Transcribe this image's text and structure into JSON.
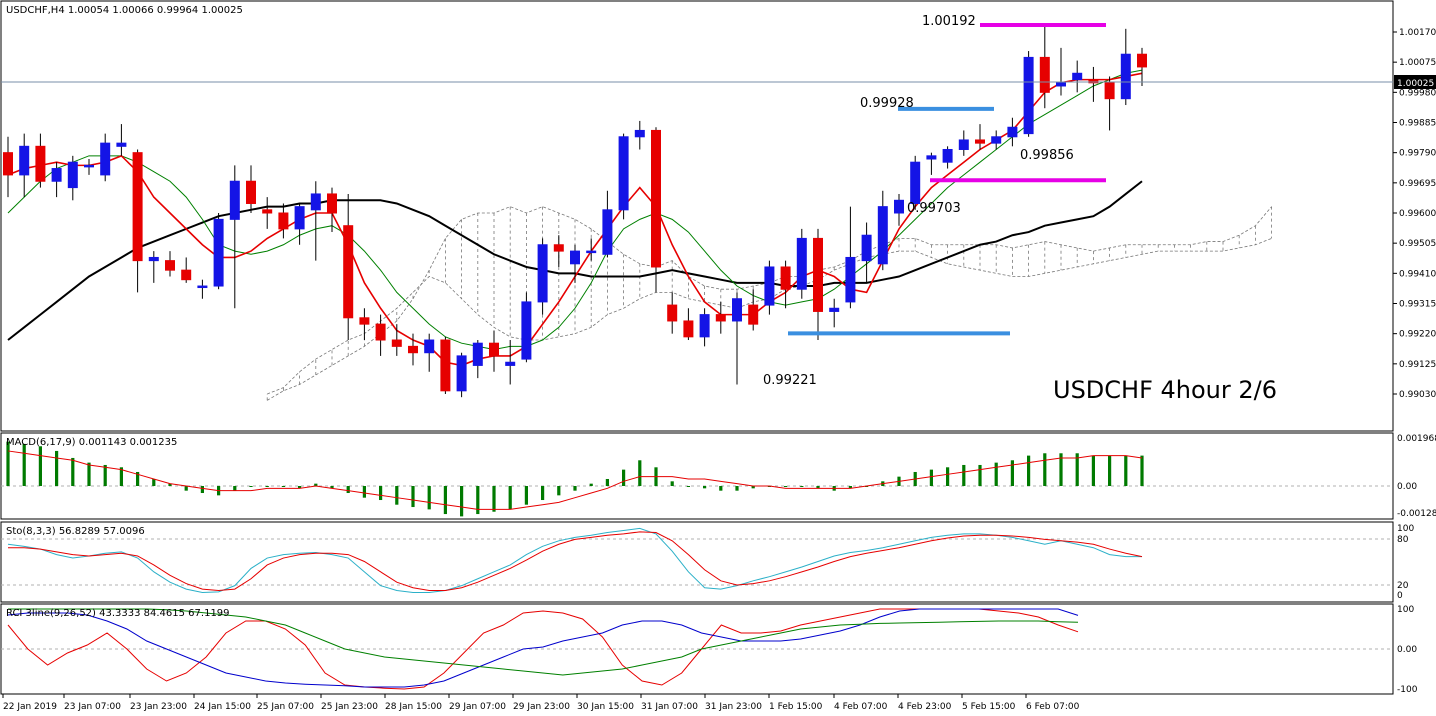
{
  "main_panel": {
    "header": "USDCHF,H4  1.00054 1.00066 0.99964 1.00025",
    "annotation": "USDCHF 4hour 2/6",
    "current_price_label": "1.00025",
    "price_ticks": [
      "1.00170",
      "1.00075",
      "0.99980",
      "0.99885",
      "0.99790",
      "0.99695",
      "0.99600",
      "0.99505",
      "0.99410",
      "0.99315",
      "0.99220",
      "0.99125",
      "0.99030"
    ],
    "level_labels": [
      {
        "text": "1.00192"
      },
      {
        "text": "0.99928"
      },
      {
        "text": "0.99703"
      },
      {
        "text": "0.99856"
      },
      {
        "text": "0.99221"
      }
    ]
  },
  "macd_panel": {
    "header": "MACD(6,17,9) 0.001143 0.001235",
    "ticks": [
      "0.001968",
      "0.00",
      "-0.001288"
    ]
  },
  "stoch_panel": {
    "header": "Sto(8,3,3) 56.8289 57.0096",
    "ticks": [
      "100",
      "80",
      "20",
      "0"
    ]
  },
  "rci_panel": {
    "header": "RCI 3line(9,26,52) 43.3333 84.4615 67.1199",
    "ticks": [
      "100",
      "0.00",
      "-100"
    ]
  },
  "time_axis": [
    "22 Jan 2019",
    "23 Jan 07:00",
    "23 Jan 23:00",
    "24 Jan 15:00",
    "25 Jan 07:00",
    "25 Jan 23:00",
    "28 Jan 15:00",
    "29 Jan 07:00",
    "29 Jan 23:00",
    "30 Jan 15:00",
    "31 Jan 07:00",
    "31 Jan 23:00",
    "1 Feb 15:00",
    "4 Feb 07:00",
    "4 Feb 23:00",
    "5 Feb 15:00",
    "6 Feb 07:00"
  ],
  "colors": {
    "bull": "#1414e6",
    "bear": "#e60000",
    "ma_fast": "#e60000",
    "ma_mid": "#008000",
    "ma_slow": "#000000",
    "line_blue": "#3a8fe0",
    "line_magenta": "#e600e6",
    "macd_hist": "#007a00",
    "macd_signal": "#e60000",
    "sto_main": "#2bb0c8",
    "sto_signal": "#e60000",
    "rci_short": "#e60000",
    "rci_mid": "#0000cc",
    "rci_long": "#008000"
  },
  "chart_data": [
    {
      "type": "candlestick",
      "title": "USDCHF,H4",
      "ylim": [
        0.9903,
        1.0022
      ],
      "candles": [
        {
          "o": 0.9979,
          "h": 0.9984,
          "l": 0.9965,
          "c": 0.9972
        },
        {
          "o": 0.9972,
          "h": 0.9985,
          "l": 0.9965,
          "c": 0.9981
        },
        {
          "o": 0.9981,
          "h": 0.9985,
          "l": 0.9968,
          "c": 0.997
        },
        {
          "o": 0.997,
          "h": 0.9976,
          "l": 0.9965,
          "c": 0.9974
        },
        {
          "o": 0.9968,
          "h": 0.9978,
          "l": 0.9964,
          "c": 0.9976
        },
        {
          "o": 0.9975,
          "h": 0.9977,
          "l": 0.9972,
          "c": 0.9975
        },
        {
          "o": 0.9972,
          "h": 0.9985,
          "l": 0.997,
          "c": 0.9982
        },
        {
          "o": 0.9981,
          "h": 0.9988,
          "l": 0.9978,
          "c": 0.9982
        },
        {
          "o": 0.9979,
          "h": 0.998,
          "l": 0.9935,
          "c": 0.9945
        },
        {
          "o": 0.9945,
          "h": 0.9948,
          "l": 0.9938,
          "c": 0.9946
        },
        {
          "o": 0.9945,
          "h": 0.9948,
          "l": 0.994,
          "c": 0.9942
        },
        {
          "o": 0.9942,
          "h": 0.9946,
          "l": 0.9938,
          "c": 0.9939
        },
        {
          "o": 0.9937,
          "h": 0.9939,
          "l": 0.9933,
          "c": 0.9937
        },
        {
          "o": 0.9937,
          "h": 0.996,
          "l": 0.9936,
          "c": 0.9958
        },
        {
          "o": 0.9958,
          "h": 0.9975,
          "l": 0.993,
          "c": 0.997
        },
        {
          "o": 0.997,
          "h": 0.9975,
          "l": 0.996,
          "c": 0.9963
        },
        {
          "o": 0.9961,
          "h": 0.9965,
          "l": 0.9955,
          "c": 0.996
        },
        {
          "o": 0.996,
          "h": 0.9963,
          "l": 0.9952,
          "c": 0.9955
        },
        {
          "o": 0.9955,
          "h": 0.9963,
          "l": 0.995,
          "c": 0.9962
        },
        {
          "o": 0.9961,
          "h": 0.997,
          "l": 0.9945,
          "c": 0.9966
        },
        {
          "o": 0.9966,
          "h": 0.9968,
          "l": 0.9954,
          "c": 0.996
        },
        {
          "o": 0.9956,
          "h": 0.9966,
          "l": 0.992,
          "c": 0.9927
        },
        {
          "o": 0.9927,
          "h": 0.993,
          "l": 0.992,
          "c": 0.9925
        },
        {
          "o": 0.9925,
          "h": 0.9928,
          "l": 0.9915,
          "c": 0.992
        },
        {
          "o": 0.992,
          "h": 0.9925,
          "l": 0.9915,
          "c": 0.9918
        },
        {
          "o": 0.9918,
          "h": 0.9922,
          "l": 0.9912,
          "c": 0.9916
        },
        {
          "o": 0.9916,
          "h": 0.9922,
          "l": 0.991,
          "c": 0.992
        },
        {
          "o": 0.992,
          "h": 0.9921,
          "l": 0.9903,
          "c": 0.9904
        },
        {
          "o": 0.9904,
          "h": 0.9916,
          "l": 0.9902,
          "c": 0.9915
        },
        {
          "o": 0.9912,
          "h": 0.992,
          "l": 0.9908,
          "c": 0.9919
        },
        {
          "o": 0.9919,
          "h": 0.9923,
          "l": 0.991,
          "c": 0.9915
        },
        {
          "o": 0.9912,
          "h": 0.992,
          "l": 0.9906,
          "c": 0.9913
        },
        {
          "o": 0.9914,
          "h": 0.9935,
          "l": 0.9913,
          "c": 0.9932
        },
        {
          "o": 0.9932,
          "h": 0.9952,
          "l": 0.9928,
          "c": 0.995
        },
        {
          "o": 0.995,
          "h": 0.9953,
          "l": 0.9943,
          "c": 0.9948
        },
        {
          "o": 0.9944,
          "h": 0.995,
          "l": 0.9938,
          "c": 0.9948
        },
        {
          "o": 0.9948,
          "h": 0.9952,
          "l": 0.9945,
          "c": 0.9948
        },
        {
          "o": 0.9947,
          "h": 0.9967,
          "l": 0.9946,
          "c": 0.9961
        },
        {
          "o": 0.9961,
          "h": 0.9985,
          "l": 0.9958,
          "c": 0.9984
        },
        {
          "o": 0.9984,
          "h": 0.9989,
          "l": 0.998,
          "c": 0.9986
        },
        {
          "o": 0.9986,
          "h": 0.9987,
          "l": 0.9935,
          "c": 0.9943
        },
        {
          "o": 0.9931,
          "h": 0.9935,
          "l": 0.9922,
          "c": 0.9926
        },
        {
          "o": 0.9926,
          "h": 0.993,
          "l": 0.992,
          "c": 0.9921
        },
        {
          "o": 0.9921,
          "h": 0.993,
          "l": 0.9918,
          "c": 0.9928
        },
        {
          "o": 0.9928,
          "h": 0.9932,
          "l": 0.9922,
          "c": 0.9926
        },
        {
          "o": 0.9926,
          "h": 0.9935,
          "l": 0.9906,
          "c": 0.9933
        },
        {
          "o": 0.9931,
          "h": 0.9936,
          "l": 0.9923,
          "c": 0.9925
        },
        {
          "o": 0.9931,
          "h": 0.9945,
          "l": 0.9928,
          "c": 0.9943
        },
        {
          "o": 0.9943,
          "h": 0.9945,
          "l": 0.993,
          "c": 0.9936
        },
        {
          "o": 0.9936,
          "h": 0.9955,
          "l": 0.9933,
          "c": 0.9952
        },
        {
          "o": 0.9952,
          "h": 0.9955,
          "l": 0.992,
          "c": 0.9929
        },
        {
          "o": 0.9929,
          "h": 0.9933,
          "l": 0.9924,
          "c": 0.993
        },
        {
          "o": 0.9932,
          "h": 0.9962,
          "l": 0.993,
          "c": 0.9946
        },
        {
          "o": 0.9945,
          "h": 0.9957,
          "l": 0.9938,
          "c": 0.9953
        },
        {
          "o": 0.9944,
          "h": 0.9967,
          "l": 0.9942,
          "c": 0.9962
        },
        {
          "o": 0.996,
          "h": 0.9966,
          "l": 0.9956,
          "c": 0.9964
        },
        {
          "o": 0.9963,
          "h": 0.9978,
          "l": 0.9961,
          "c": 0.9976
        },
        {
          "o": 0.9977,
          "h": 0.9979,
          "l": 0.9972,
          "c": 0.9978
        },
        {
          "o": 0.9976,
          "h": 0.9981,
          "l": 0.9974,
          "c": 0.998
        },
        {
          "o": 0.998,
          "h": 0.9986,
          "l": 0.9978,
          "c": 0.9983
        },
        {
          "o": 0.9983,
          "h": 0.9988,
          "l": 0.998,
          "c": 0.9982
        },
        {
          "o": 0.9982,
          "h": 0.9986,
          "l": 0.998,
          "c": 0.9984
        },
        {
          "o": 0.9984,
          "h": 0.999,
          "l": 0.9981,
          "c": 0.9987
        },
        {
          "o": 0.9985,
          "h": 1.0011,
          "l": 0.9984,
          "c": 1.0009
        },
        {
          "o": 1.0009,
          "h": 1.0019,
          "l": 0.9993,
          "c": 0.9998
        },
        {
          "o": 1.0,
          "h": 1.0012,
          "l": 0.9997,
          "c": 1.0001
        },
        {
          "o": 1.0002,
          "h": 1.0008,
          "l": 0.9998,
          "c": 1.0004
        },
        {
          "o": 1.0002,
          "h": 1.0006,
          "l": 0.9995,
          "c": 1.0001
        },
        {
          "o": 1.0001,
          "h": 1.0003,
          "l": 0.9986,
          "c": 0.9996
        },
        {
          "o": 0.9996,
          "h": 1.0018,
          "l": 0.9994,
          "c": 1.001
        },
        {
          "o": 1.001,
          "h": 1.0012,
          "l": 1.0,
          "c": 1.0006
        }
      ]
    },
    {
      "type": "bar",
      "title": "MACD(6,17,9) 0.001143 0.001235",
      "values": [
        0.0019,
        0.0018,
        0.0017,
        0.0015,
        0.0012,
        0.001,
        0.0009,
        0.0008,
        0.0006,
        0.0003,
        0.0001,
        -0.0002,
        -0.0003,
        -0.0004,
        -0.0002,
        0.0,
        0.0,
        0.0,
        -0.0001,
        0.0001,
        -0.0001,
        -0.0003,
        -0.0005,
        -0.0006,
        -0.0008,
        -0.0009,
        -0.001,
        -0.0012,
        -0.0013,
        -0.0012,
        -0.0011,
        -0.001,
        -0.0008,
        -0.0006,
        -0.0004,
        -0.0002,
        0.0001,
        0.0003,
        0.0007,
        0.0011,
        0.0008,
        0.0002,
        0.0,
        -0.0001,
        -0.0002,
        -0.0002,
        -0.0001,
        0.0,
        0.0,
        0.0,
        -0.0001,
        -0.0002,
        -0.0001,
        0.0,
        0.0002,
        0.0004,
        0.0006,
        0.0007,
        0.0008,
        0.0009,
        0.0009,
        0.001,
        0.0011,
        0.0013,
        0.0014,
        0.0014,
        0.0014,
        0.0013,
        0.0013,
        0.0013,
        0.0013
      ],
      "signal": [
        0.0015,
        0.0014,
        0.0013,
        0.0012,
        0.0011,
        0.0009,
        0.0008,
        0.0007,
        0.0005,
        0.0003,
        0.0001,
        0.0,
        -0.0001,
        -0.0002,
        -0.0002,
        -0.0002,
        -0.0001,
        -0.0001,
        -0.0001,
        0.0,
        -0.0001,
        -0.0002,
        -0.0003,
        -0.0004,
        -0.0005,
        -0.0006,
        -0.0007,
        -0.0008,
        -0.0009,
        -0.001,
        -0.001,
        -0.001,
        -0.0009,
        -0.0008,
        -0.0007,
        -0.0005,
        -0.0003,
        -0.0001,
        0.0002,
        0.0004,
        0.0004,
        0.0004,
        0.0003,
        0.0003,
        0.0002,
        0.0001,
        0.0,
        0.0,
        -0.0001,
        -0.0001,
        -0.0001,
        -0.0001,
        -0.0001,
        0.0,
        0.0001,
        0.0002,
        0.0003,
        0.0004,
        0.0005,
        0.0006,
        0.0007,
        0.0008,
        0.0009,
        0.001,
        0.0011,
        0.0012,
        0.0012,
        0.0013,
        0.0013,
        0.0013,
        0.0012
      ],
      "ylim": [
        -0.0013,
        0.002
      ]
    },
    {
      "type": "line",
      "title": "Sto(8,3,3) 56.8289 57.0096",
      "ylim": [
        0,
        100
      ],
      "series": [
        {
          "values": [
            75,
            72,
            68,
            60,
            55,
            58,
            62,
            64,
            55,
            35,
            20,
            10,
            5,
            6,
            15,
            40,
            55,
            60,
            62,
            63,
            60,
            55,
            35,
            15,
            8,
            5,
            5,
            8,
            15,
            25,
            35,
            45,
            60,
            72,
            80,
            85,
            88,
            92,
            95,
            98,
            90,
            65,
            35,
            12,
            10,
            15,
            22,
            28,
            35,
            42,
            50,
            58,
            63,
            66,
            70,
            75,
            80,
            85,
            88,
            90,
            90,
            88,
            85,
            80,
            75,
            80,
            75,
            70,
            60,
            57,
            57
          ]
        },
        {
          "values": [
            70,
            70,
            68,
            64,
            60,
            58,
            60,
            62,
            58,
            45,
            30,
            18,
            10,
            8,
            10,
            25,
            45,
            55,
            60,
            62,
            62,
            60,
            50,
            35,
            20,
            12,
            8,
            8,
            12,
            20,
            30,
            40,
            52,
            65,
            75,
            82,
            85,
            88,
            90,
            93,
            92,
            80,
            60,
            38,
            22,
            16,
            18,
            22,
            28,
            35,
            42,
            50,
            57,
            62,
            66,
            70,
            75,
            80,
            84,
            87,
            88,
            88,
            87,
            85,
            82,
            80,
            78,
            75,
            68,
            62,
            57
          ]
        }
      ]
    },
    {
      "type": "line",
      "title": "RCI 3line(9,26,52) 43.3333 84.4615 67.1199",
      "ylim": [
        -100,
        100
      ],
      "series": [
        {
          "values": [
            60,
            0,
            -40,
            -10,
            10,
            40,
            0,
            -50,
            -80,
            -60,
            -20,
            40,
            70,
            70,
            50,
            10,
            -60,
            -90,
            -95,
            -98,
            -100,
            -95,
            -60,
            -10,
            40,
            60,
            90,
            95,
            90,
            75,
            30,
            -40,
            -80,
            -90,
            -60,
            0,
            60,
            40,
            40,
            45,
            60,
            70,
            80,
            90,
            100,
            100,
            100,
            100,
            100,
            100,
            95,
            90,
            80,
            60,
            43
          ]
        },
        {
          "values": [
            85,
            90,
            90,
            90,
            85,
            70,
            50,
            20,
            0,
            -20,
            -40,
            -60,
            -70,
            -80,
            -85,
            -88,
            -90,
            -92,
            -95,
            -95,
            -95,
            -90,
            -80,
            -60,
            -40,
            -20,
            0,
            5,
            20,
            30,
            40,
            60,
            70,
            70,
            60,
            40,
            30,
            20,
            20,
            20,
            25,
            35,
            45,
            60,
            80,
            95,
            100,
            100,
            100,
            100,
            100,
            100,
            100,
            100,
            84
          ]
        },
        {
          "values": [
            100,
            100,
            100,
            100,
            100,
            100,
            100,
            100,
            98,
            95,
            90,
            85,
            80,
            70,
            60,
            40,
            20,
            0,
            -10,
            -20,
            -25,
            -30,
            -35,
            -40,
            -45,
            -50,
            -55,
            -60,
            -65,
            -60,
            -55,
            -50,
            -40,
            -30,
            -20,
            0,
            10,
            20,
            30,
            40,
            50,
            55,
            60,
            62,
            64,
            65,
            66,
            67,
            68,
            69,
            70,
            70,
            70,
            68,
            67
          ]
        }
      ]
    }
  ]
}
